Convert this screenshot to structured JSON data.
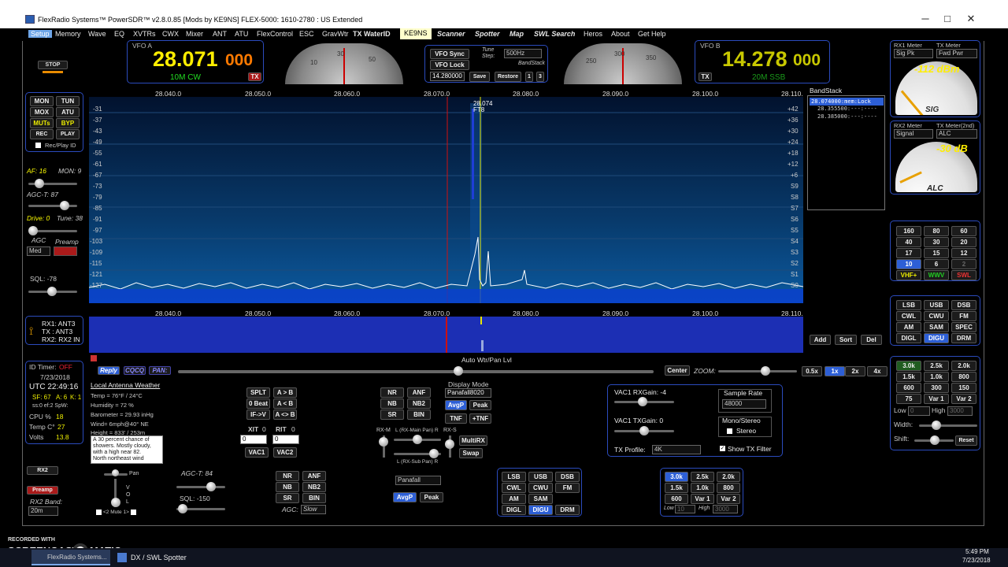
{
  "window": {
    "title": "FlexRadio Systems™  PowerSDR™ v2.8.0.85   [Mods by KE9NS]   FLEX-5000: 1610-2780 : US Extended",
    "min": "─",
    "max": "□",
    "close": "✕"
  },
  "menu": [
    "Setup",
    "Memory",
    "Wave",
    "EQ",
    "XVTRs",
    "CWX",
    "Mixer",
    "ANT",
    "ATU",
    "FlexControl",
    "ESC",
    "GravWtr"
  ],
  "menu_tx": "TX WaterID",
  "menu_call": "KE9NS",
  "menu_right": [
    "Scanner",
    "Spotter",
    "Map",
    "SWL Search"
  ],
  "menu_right2": [
    "Heros",
    "About",
    "Get Help"
  ],
  "vfoa": {
    "label": "VFO A",
    "freq_main": "28.071",
    "freq_sub": "000",
    "mode": "10M CW",
    "tx": "TX"
  },
  "vfob": {
    "label": "VFO B",
    "freq_main": "14.278",
    "freq_sub": "000",
    "mode": "20M SSB",
    "tx": "TX"
  },
  "vfoctrl": {
    "sync": "VFO Sync",
    "lock": "VFO Lock",
    "tune_step": "Tune Step:",
    "step_val": "500Hz",
    "bandstack": "BandStack",
    "save_freq": "14.280000",
    "save": "Save",
    "restore": "Restore",
    "b1": "1",
    "b2": "3"
  },
  "dial_a": [
    "10",
    "30",
    "50"
  ],
  "dial_b": [
    "250",
    "300",
    "350"
  ],
  "stop": "STOP",
  "leftbtns": [
    [
      "MON",
      "TUN"
    ],
    [
      "MOX",
      "ATU"
    ],
    [
      "MUTs",
      "BYP"
    ],
    [
      "REC",
      "PLAY"
    ]
  ],
  "recplay": "Rec/Play ID",
  "af": "AF: 16",
  "mon": "MON: 9",
  "agct": "AGC-T: 87",
  "drive": "Drive: 0",
  "tune": "Tune: 38",
  "agc": "AGC",
  "preamp": "Preamp",
  "agc_val": "Med",
  "sql": "SQL: -78",
  "ant": {
    "rx1": "RX1: ANT3",
    "tx": "TX  : ANT3",
    "rx2": "RX2: RX2 IN"
  },
  "idtimer": {
    "label": "ID Timer:",
    "state": "OFF",
    "date": "7/23/2018",
    "utc": "UTC  22:49:16",
    "sf": "SF: 67",
    "a": "A: 6",
    "k": "K: 1",
    "ss": "ss:0 ef:2 SpW:",
    "cpu": "CPU %",
    "cpu_v": "18",
    "temp": "Temp C°",
    "temp_v": "27",
    "volts": "Volts",
    "volts_v": "13.8"
  },
  "rx2": {
    "btn": "RX2",
    "preamp": "Preamp",
    "band": "RX2 Band:",
    "band_val": "20m",
    "pan": "Pan",
    "vol": "V O L",
    "mute": "<2 Mute 1>"
  },
  "rx2ctl": {
    "agct": "AGC-T: 84",
    "sql": "SQL: -150"
  },
  "freq_ticks": [
    "28.040.0",
    "28.050.0",
    "28.060.0",
    "28.070.0",
    "28.080.0",
    "28.090.0",
    "28.100.0",
    "28.110."
  ],
  "db_left": [
    "-31",
    "-37",
    "-43",
    "-49",
    "-55",
    "-61",
    "-67",
    "-73",
    "-79",
    "-85",
    "-91",
    "-97",
    "-103",
    "-109",
    "-115",
    "-121",
    "-127"
  ],
  "db_right": [
    "+42",
    "+36",
    "+30",
    "+24",
    "+18",
    "+12",
    "+6",
    "S9",
    "S8",
    "S7",
    "S6",
    "S5",
    "S4",
    "S3",
    "S2",
    "S1",
    "S0"
  ],
  "spot": {
    "freq": "28.074",
    "mode": "FT8"
  },
  "bandstack_panel": {
    "title": "BandStack",
    "entries": [
      "28.074000:mem:Lock",
      "28.355500:---:----",
      "28.385000:---:----"
    ],
    "add": "Add",
    "sort": "Sort",
    "del": "Del"
  },
  "meters": {
    "rx1": "RX1 Meter",
    "tx": "TX Meter",
    "rx1_sel": "Sig Pk",
    "tx_sel": "Fwd Pwr",
    "reading1": "-112 dBm",
    "sig": "SIG",
    "rx2": "RX2 Meter",
    "tx2": "TX Meter(2nd)",
    "rx2_sel": "Signal",
    "tx2_sel": "ALC",
    "reading2": "-30 dB",
    "alc": "ALC"
  },
  "bands": [
    [
      "160",
      "80",
      "60"
    ],
    [
      "40",
      "30",
      "20"
    ],
    [
      "17",
      "15",
      "12"
    ],
    [
      "10",
      "6",
      "2"
    ],
    [
      "VHF+",
      "WWV",
      "SWL"
    ]
  ],
  "modes": [
    [
      "LSB",
      "USB",
      "DSB"
    ],
    [
      "CWL",
      "CWU",
      "FM"
    ],
    [
      "AM",
      "SAM",
      "SPEC"
    ],
    [
      "DIGL",
      "DIGU",
      "DRM"
    ]
  ],
  "filters": [
    [
      "3.0k",
      "2.5k",
      "2.0k"
    ],
    [
      "1.5k",
      "1.0k",
      "800"
    ],
    [
      "600",
      "300",
      "150"
    ],
    [
      "75",
      "Var 1",
      "Var 2"
    ]
  ],
  "filter_ctl": {
    "low": "Low",
    "high": "High",
    "low_v": "0",
    "high_v": "3000",
    "width": "Width:",
    "shift": "Shift:",
    "reset": "Reset"
  },
  "reply": "Reply",
  "cqcq": "CQCQ",
  "pan_btn": "PAN:",
  "autowtr": "Auto Wtr/Pan Lvl",
  "center": "Center",
  "zoom": "ZOOM:",
  "zooms": [
    "0.5x",
    "1x",
    "2x",
    "4x"
  ],
  "weather": {
    "title": "Local Antenna Weather",
    "lines": [
      "Temp = 76°F / 24°C",
      "Humidity = 72 %",
      "Barometer = 29.93 inHg",
      "Wind= 6mph@40° NE",
      "Height = 833' / 253m",
      "A 30 percent chance of",
      "showers.  Mostly cloudy,",
      "with a high near 82.",
      "North northeast wind"
    ]
  },
  "split": [
    [
      "SPLT",
      "A > B"
    ],
    [
      "0 Beat",
      "A < B"
    ],
    [
      "IF->V",
      "A <> B"
    ]
  ],
  "xit": "XIT",
  "rit": "RIT",
  "xit_v": "0",
  "rit_v": "0",
  "vac1": "VAC1",
  "vac2": "VAC2",
  "dsp1": [
    [
      "NR",
      "ANF"
    ],
    [
      "NB",
      "NB2"
    ],
    [
      "SR",
      "BIN"
    ]
  ],
  "display_mode": "Display Mode",
  "display_sel": "Panafall8020",
  "avgp": "AvgP",
  "peak": "Peak",
  "tnf": "TNF",
  "ptnf": "+TNF",
  "rxm": "RX-M",
  "rxs": "RX-S",
  "lrxmain": "L (RX-Main Pan) R",
  "lrxsub": "L (RX-Sub Pan) R",
  "multirx": "MultiRX",
  "swap": "Swap",
  "dsp2": [
    [
      "NR",
      "ANF"
    ],
    [
      "NB",
      "NB2"
    ],
    [
      "SR",
      "BIN"
    ]
  ],
  "agc2": "AGC:",
  "agc2_v": "Slow",
  "display2_sel": "Panafall",
  "avgp2": "AvgP",
  "peak2": "Peak",
  "modes2": [
    [
      "LSB",
      "USB",
      "DSB"
    ],
    [
      "CWL",
      "CWU",
      "FM"
    ],
    [
      "AM",
      "SAM",
      ""
    ],
    [
      "DIGL",
      "DIGU",
      "DRM"
    ]
  ],
  "filters2": [
    [
      "3.0k",
      "2.5k",
      "2.0k"
    ],
    [
      "1.5k",
      "1.0k",
      "800"
    ],
    [
      "600",
      "Var 1",
      "Var 2"
    ]
  ],
  "filters2_ctl": {
    "low": "Low",
    "low_v": "10",
    "high": "High",
    "high_v": "3000"
  },
  "vac": {
    "rxgain": "VAC1 RXGain: -4",
    "txgain": "VAC1 TXGain: 0",
    "txprofile": "TX Profile:",
    "profile_v": "4K",
    "sr": "Sample Rate",
    "sr_v": "48000",
    "mono": "Mono/Stereo",
    "stereo": "Stereo",
    "showtx": "Show TX Filter"
  },
  "recorded": "RECORDED WITH",
  "screencast": "SCREENCAST",
  "matic": "MATIC",
  "taskbar": {
    "app1": "FlexRadio Systems...",
    "app2": "DX / SWL Spotter",
    "time": "5:49 PM",
    "date": "7/23/2018"
  },
  "colors": {
    "vfo_a": "#ffee00",
    "vfo_b": "#c8c800",
    "mode_green": "#22dd22",
    "panel_border": "#2b4bbd",
    "accent_blue": "#2d5fd6"
  }
}
